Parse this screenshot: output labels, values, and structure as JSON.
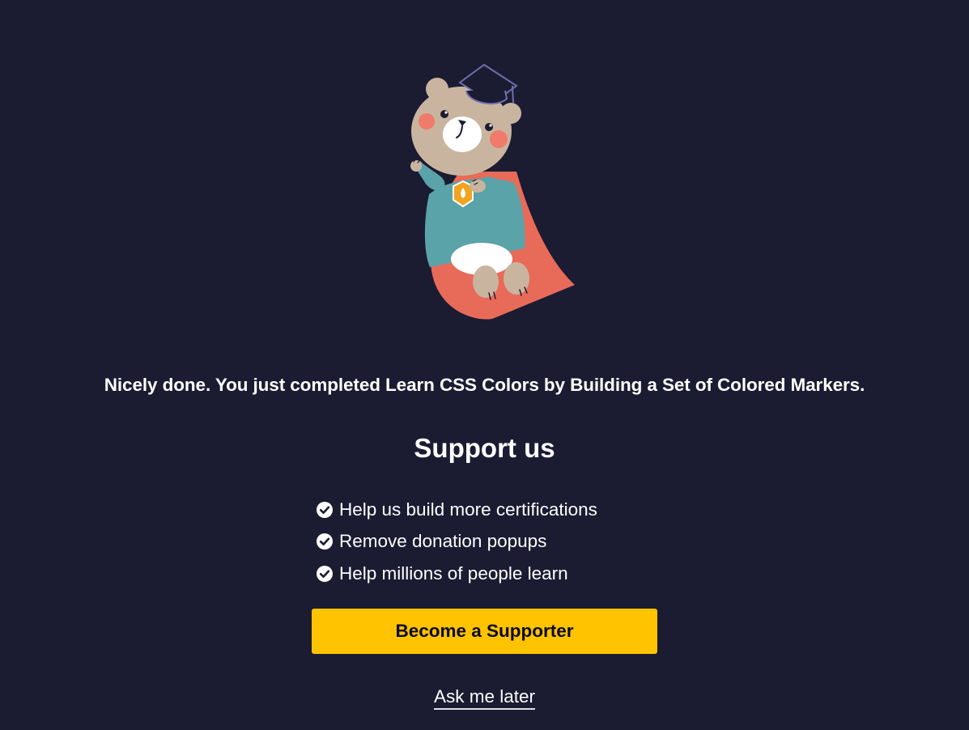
{
  "completion_message": "Nicely done. You just completed Learn CSS Colors by Building a Set of Colored Markers.",
  "support": {
    "heading": "Support us",
    "benefits": [
      "Help us build more certifications",
      "Remove donation popups",
      "Help millions of people learn"
    ],
    "supporter_button_label": "Become a Supporter",
    "ask_later_label": "Ask me later"
  },
  "colors": {
    "background": "#1b1b32",
    "button": "#ffc300",
    "button_text": "#0a0a23",
    "text": "#ffffff"
  },
  "icons": {
    "illustration": "graduate-bear-cape-illustration",
    "benefit_marker": "check-circle-icon"
  }
}
